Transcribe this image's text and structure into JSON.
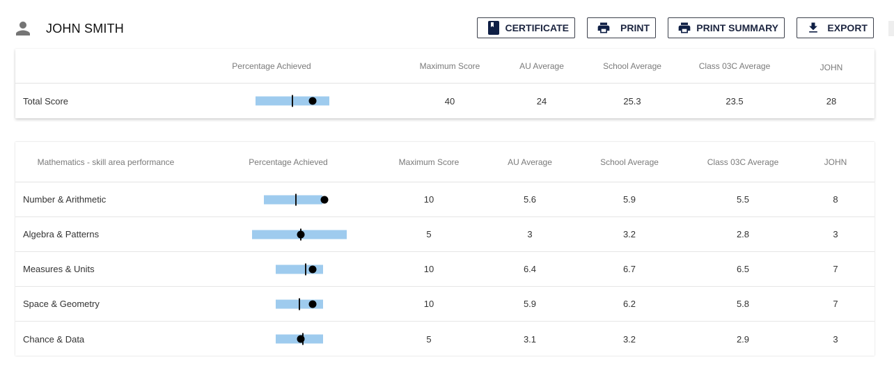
{
  "header": {
    "user_icon": "person-icon",
    "user_name": "JOHN SMITH",
    "buttons": [
      {
        "label": "CERTIFICATE",
        "icon": "bookmark-book-icon"
      },
      {
        "label": "PRINT",
        "icon": "printer-icon"
      },
      {
        "label": "PRINT SUMMARY",
        "icon": "printer-icon"
      },
      {
        "label": "EXPORT",
        "icon": "download-icon"
      }
    ]
  },
  "colors": {
    "range_bar": "#9ecbee",
    "button_text": "#1c2540",
    "header_text": "#7a7a7a"
  },
  "total_table": {
    "columns": [
      "",
      "Percentage Achieved",
      "Maximum Score",
      "AU Average",
      "School Average",
      "Class 03C Average",
      "JOHN"
    ],
    "rows": [
      {
        "label": "Total Score",
        "max": "40",
        "au_avg": "24",
        "school_avg": "25.3",
        "class_avg": "23.5",
        "student": "28",
        "pct": {
          "range_min": 0.22,
          "range_max": 0.84,
          "average": 0.53,
          "student": 0.7
        }
      }
    ]
  },
  "skills_table": {
    "columns": [
      "Mathematics - skill area performance",
      "Percentage Achieved",
      "Maximum Score",
      "AU Average",
      "School Average",
      "Class 03C Average",
      "JOHN"
    ],
    "rows": [
      {
        "label": "Number & Arithmetic",
        "max": "10",
        "au_avg": "5.6",
        "school_avg": "5.9",
        "class_avg": "5.5",
        "student": "8",
        "pct": {
          "range_min": 0.29,
          "range_max": 0.78,
          "average": 0.56,
          "student": 0.8
        }
      },
      {
        "label": "Algebra & Patterns",
        "max": "5",
        "au_avg": "3",
        "school_avg": "3.2",
        "class_avg": "2.8",
        "student": "3",
        "pct": {
          "range_min": 0.19,
          "range_max": 0.99,
          "average": 0.6,
          "student": 0.6
        }
      },
      {
        "label": "Measures & Units",
        "max": "10",
        "au_avg": "6.4",
        "school_avg": "6.7",
        "class_avg": "6.5",
        "student": "7",
        "pct": {
          "range_min": 0.39,
          "range_max": 0.79,
          "average": 0.64,
          "student": 0.7
        }
      },
      {
        "label": "Space & Geometry",
        "max": "10",
        "au_avg": "5.9",
        "school_avg": "6.2",
        "class_avg": "5.8",
        "student": "7",
        "pct": {
          "range_min": 0.39,
          "range_max": 0.79,
          "average": 0.59,
          "student": 0.7
        }
      },
      {
        "label": "Chance & Data",
        "max": "5",
        "au_avg": "3.1",
        "school_avg": "3.2",
        "class_avg": "2.9",
        "student": "3",
        "pct": {
          "range_min": 0.39,
          "range_max": 0.79,
          "average": 0.62,
          "student": 0.6
        }
      }
    ]
  }
}
